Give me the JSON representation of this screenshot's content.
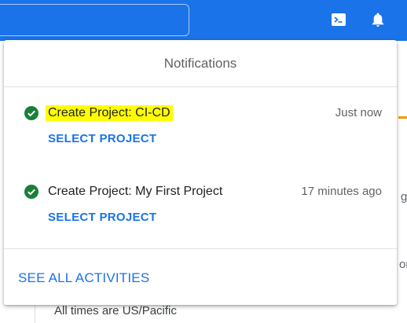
{
  "panel": {
    "title": "Notifications",
    "notifications": [
      {
        "title": "Create Project: CI-CD",
        "time": "Just now",
        "action": "SELECT PROJECT",
        "status": "success",
        "highlighted": true
      },
      {
        "title": "Create Project: My First Project",
        "time": "17 minutes ago",
        "action": "SELECT PROJECT",
        "status": "success",
        "highlighted": false
      }
    ],
    "see_all_label": "SEE ALL ACTIVITIES"
  },
  "topbar": {
    "icons": [
      "terminal-icon",
      "bell-icon"
    ]
  },
  "background": {
    "footer_text": "All times are US/Pacific",
    "edge_letters": [
      "g",
      "on"
    ]
  },
  "colors": {
    "brand": "#1a73e8",
    "success": "#188038",
    "highlight": "#ffff00",
    "accent": "#f29900"
  }
}
